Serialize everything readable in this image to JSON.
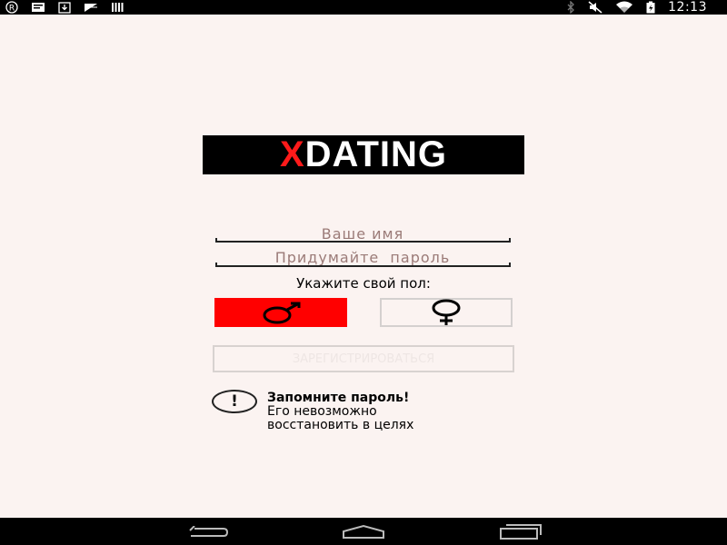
{
  "status_bar": {
    "left_icons": [
      "registered-icon",
      "message-icon",
      "download-icon",
      "mail-icon",
      "barcode-icon"
    ],
    "right_icons": [
      "bluetooth-icon",
      "mute-icon",
      "wifi-icon",
      "battery-charging-icon"
    ],
    "time": "12:13"
  },
  "logo": {
    "x": "X",
    "rest": "DATING",
    "colors": {
      "x": "#ff1a1a",
      "rest": "#ffffff",
      "background": "#000000"
    }
  },
  "form": {
    "name_placeholder": "Ваше имя",
    "password_placeholder": "Придумайте  пароль",
    "gender_label": "Укажите свой пол:",
    "male_icon": "male-symbol-icon",
    "female_icon": "female-symbol-icon",
    "selected_gender": "male",
    "accent_color": "#ff0000",
    "register_label": "ЗАРЕГИСТРИРОВАТЬСЯ"
  },
  "notice": {
    "icon_text": "!",
    "title": "Запомните пароль!",
    "text": "Его невозможно\nвосстановить в целях"
  },
  "nav_bar": {
    "icons": [
      "back-icon",
      "home-icon",
      "recent-apps-icon"
    ]
  }
}
